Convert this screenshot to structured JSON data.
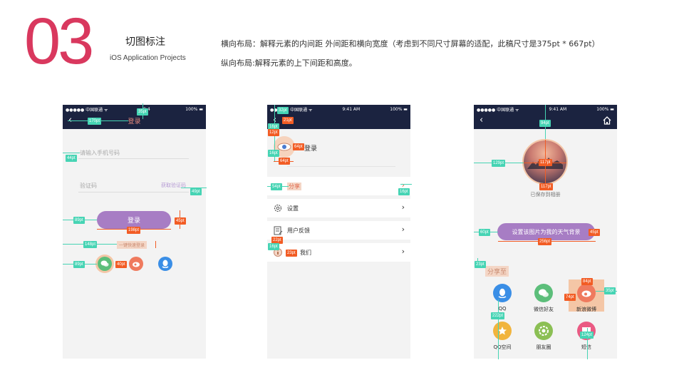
{
  "header": {
    "number": "03",
    "title": "切图标注",
    "subtitle": "iOS Application Projects",
    "desc_line1": "横向布局：解释元素的内间距  外间距和横向宽度（考虑到不同尺寸屏幕的适配，此稿尺寸是375pt * 667pt）",
    "desc_line2": "纵向布局:解释元素的上下间距和高度。"
  },
  "status": {
    "carrier": "●●●●● 中国联通 ᯤ",
    "time1": "9:4",
    "time2": "9:41 AM",
    "time3": "9:41 AM",
    "battery": "100% ▬"
  },
  "phone1": {
    "nav_title": "登录",
    "phone_placeholder": "请输入手机号码",
    "code_placeholder": "验证码",
    "get_code": "获取验证码",
    "login_button": "登录",
    "quick_login": "一键快速登录",
    "tags": {
      "t35": "35pt",
      "t170": "170pt",
      "t44": "44pt",
      "t49": "49pt",
      "t89a": "89pt",
      "t45": "45pt",
      "t198": "198pt",
      "t148": "148pt",
      "t89b": "89pt",
      "t40": "40pt"
    }
  },
  "phone2": {
    "profile_label": "登录",
    "share": "分享",
    "settings": "设置",
    "feedback": "用户反馈",
    "about": "我们",
    "tags": {
      "t32": "32pt",
      "t21": "21pt",
      "t16a": "16pt",
      "t12": "12pt",
      "t16b": "16pt",
      "t64a": "64pt",
      "t64b": "64pt",
      "t54": "54pt",
      "t16c": "16pt",
      "t22": "22pt",
      "t16d": "16pt",
      "t23": "23pt"
    }
  },
  "phone3": {
    "saved_label": "已保存到相册",
    "set_bg_button": "设置该图片为我的天气背景",
    "share_to": "分享至",
    "share_items": [
      "QQ",
      "微信好友",
      "新浪微博",
      "QQ空间",
      "朋友圈",
      "短信"
    ],
    "tags": {
      "t94": "94pt",
      "t129": "129pt",
      "t117a": "117pt",
      "t117b": "117pt",
      "t60": "60pt",
      "t45": "45pt",
      "t256": "256pt",
      "t23": "23pt",
      "t84": "84pt",
      "t74": "74pt",
      "t35": "35pt",
      "t222": "222pt",
      "t124": "124pt"
    }
  },
  "colors": {
    "accent": "#d9385e",
    "nav": "#1b2340",
    "guide_green": "#46d4b4",
    "guide_orange": "#f25c24",
    "login_purple": "#a77dc4"
  }
}
